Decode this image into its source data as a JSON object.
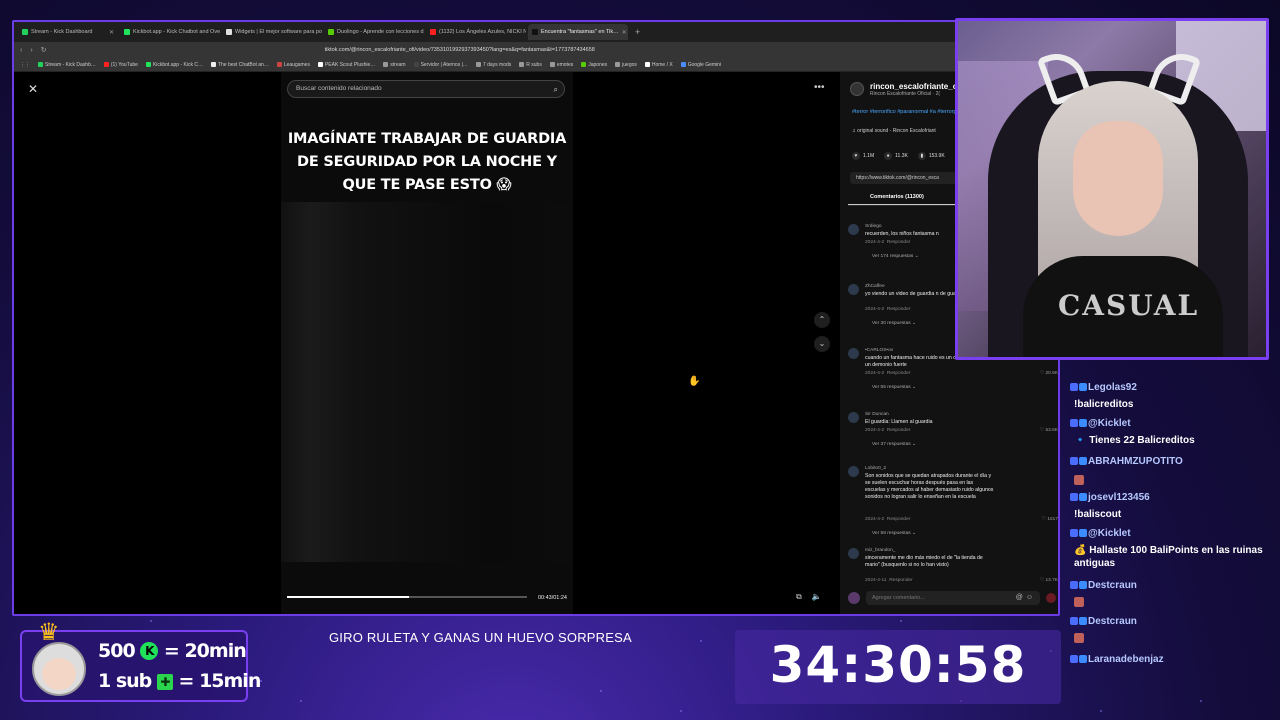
{
  "browser": {
    "tabs": [
      {
        "label": "Stream - Kick Dashboard",
        "color": "#21d35a"
      },
      {
        "label": "Kickbot.app - Kick Chatbot and Overl…",
        "color": "#1fe25a"
      },
      {
        "label": "Widgets | El mejor software para po…",
        "color": "#e0e0e0"
      },
      {
        "label": "Duolingo - Aprende con lecciones d…",
        "color": "#58cc02"
      },
      {
        "label": "(1132) Los Ángeles Azules, NICKI NI…",
        "color": "#ff2020"
      },
      {
        "label": "Encuentra \"fantasmas\" en Tik…",
        "color": "#111111"
      }
    ],
    "new_tab": "+",
    "url": "tiktok.com/@rincon_escalofriante_ofi/video/7353101992937393450?lang=es&q=fantasmas&t=1773787434658",
    "bookmarks": [
      {
        "label": "Stream - Kick Dashb…",
        "color": "#21d35a"
      },
      {
        "label": "(1) YouTube",
        "color": "#ff2020"
      },
      {
        "label": "Kickbot.app - Kick C…",
        "color": "#1fe25a"
      },
      {
        "label": "The best ChatBot an…",
        "color": "#eeeeee"
      },
      {
        "label": "Leaugames",
        "color": "#cc4444"
      },
      {
        "label": "PEAK Scout Plushie…",
        "color": "#ffffff"
      },
      {
        "label": "stream",
        "color": "#999999"
      },
      {
        "label": "Servidor | Aternos |…",
        "color": "#444444"
      },
      {
        "label": "7 days mods",
        "color": "#999999"
      },
      {
        "label": "R subs",
        "color": "#999999"
      },
      {
        "label": "emotes",
        "color": "#999999"
      },
      {
        "label": "Japones",
        "color": "#58cc02"
      },
      {
        "label": "juegos",
        "color": "#999999"
      },
      {
        "label": "Home / X",
        "color": "#ffffff"
      },
      {
        "label": "Google Gemini",
        "color": "#4a8cff"
      }
    ]
  },
  "tiktok": {
    "search_placeholder": "Buscar contenido relacionado",
    "caption": "IMAGÍNATE TRABAJAR DE GUARDIA DE SEGURIDAD POR LA NOCHE Y QUE TE PASE ESTO 😱",
    "time": "00:43/01:24",
    "progress": 0.51,
    "author_name": "rincon_escalofriante_of",
    "author_sub": "Rincon Escalofriante Oficial · 2(",
    "tags": "#terror #terrorifico #paranormal #a #terrorparanormal #miedo #mied",
    "sound": "♫ original sound - Rincon Escalofriant",
    "stats": {
      "likes": "1.1M",
      "comments": "11.3K",
      "saves": "153.9K"
    },
    "link": "https://www.tiktok.com/@rincon_esca",
    "comments_tab": "Comentarios (11300)",
    "comment_placeholder": "Agregar comentario...",
    "comments": [
      {
        "user": "Srdiego",
        "text": "recuerden, los niños fantasma n",
        "date": "2024-4-2",
        "reply": "Responder",
        "replies": "Ver 174 respuestas ⌄",
        "likes": ""
      },
      {
        "user": "ZhCaffee",
        "text": "yo viendo un video de guardia n de guardia nocturno",
        "date": "2024-4-2",
        "reply": "Responder",
        "replies": "Ver 30 respuestas ⌄",
        "likes": ""
      },
      {
        "user": "•CARLOS•ov",
        "text": "cuando un fantasma hace ruido es un demonio mayor un demonio fuerte",
        "date": "2024-4-2",
        "reply": "Responder",
        "replies": "Ver 55 respuestas ⌄",
        "likes": "♡ 20.6K"
      },
      {
        "user": "Sir Duncan",
        "text": "El guardia: Llamen al guardia",
        "date": "2024-4-2",
        "reply": "Responder",
        "replies": "Ver 37 respuestas ⌄",
        "likes": "♡ 53.6K"
      },
      {
        "user": "Lobito0_2",
        "text": "Son sonidos que se quedan atrapados durante el día y se suelen escuchar horas después pasa en las escuelas y mercados al haber demasiado ruido algunos sonidos no logran salir lo enseñan en la escuela",
        "date": "2024-4-2",
        "reply": "Responder",
        "replies": "Ver 58 respuestas ⌄",
        "likes": "♡ 1617"
      },
      {
        "user": "miz_brandon_",
        "text": "sinceramente me dio más miedo el de \"la tienda de mario\" (busquenlo si no lo han visto)",
        "date": "2024-4-11",
        "reply": "Responder",
        "replies": "",
        "likes": "♡ 13.7K"
      }
    ]
  },
  "webcam": {
    "shirt_text": "CASUAL"
  },
  "chat": [
    {
      "type": "user",
      "name": "Legolas92"
    },
    {
      "type": "msg",
      "text": "!balicreditos"
    },
    {
      "type": "user",
      "name": "@Kicklet"
    },
    {
      "type": "msg",
      "text": "🔹 Tienes 22 Balicreditos"
    },
    {
      "type": "user",
      "name": "ABRAHMZUPOTITO"
    },
    {
      "type": "msg",
      "text": ""
    },
    {
      "type": "user",
      "name": "josevl123456"
    },
    {
      "type": "msg",
      "text": "!baliscout"
    },
    {
      "type": "user",
      "name": "@Kicklet"
    },
    {
      "type": "msg",
      "text": "💰 Hallaste 100 BaliPoints en las ruinas antiguas"
    },
    {
      "type": "user",
      "name": "Destcraun"
    },
    {
      "type": "msg",
      "text": ""
    },
    {
      "type": "user",
      "name": "Destcraun"
    },
    {
      "type": "msg",
      "text": ""
    },
    {
      "type": "user",
      "name": "Laranadebenjaz"
    }
  ],
  "overlay": {
    "goal_line1_a": "500",
    "goal_line1_b": "= 20min",
    "goal_line2_a": "1 sub",
    "goal_line2_b": "= 15min",
    "ticker": "GIRO RULETA Y GANAS UN HUEVO SORPRESA",
    "timer": "34:30:58"
  }
}
